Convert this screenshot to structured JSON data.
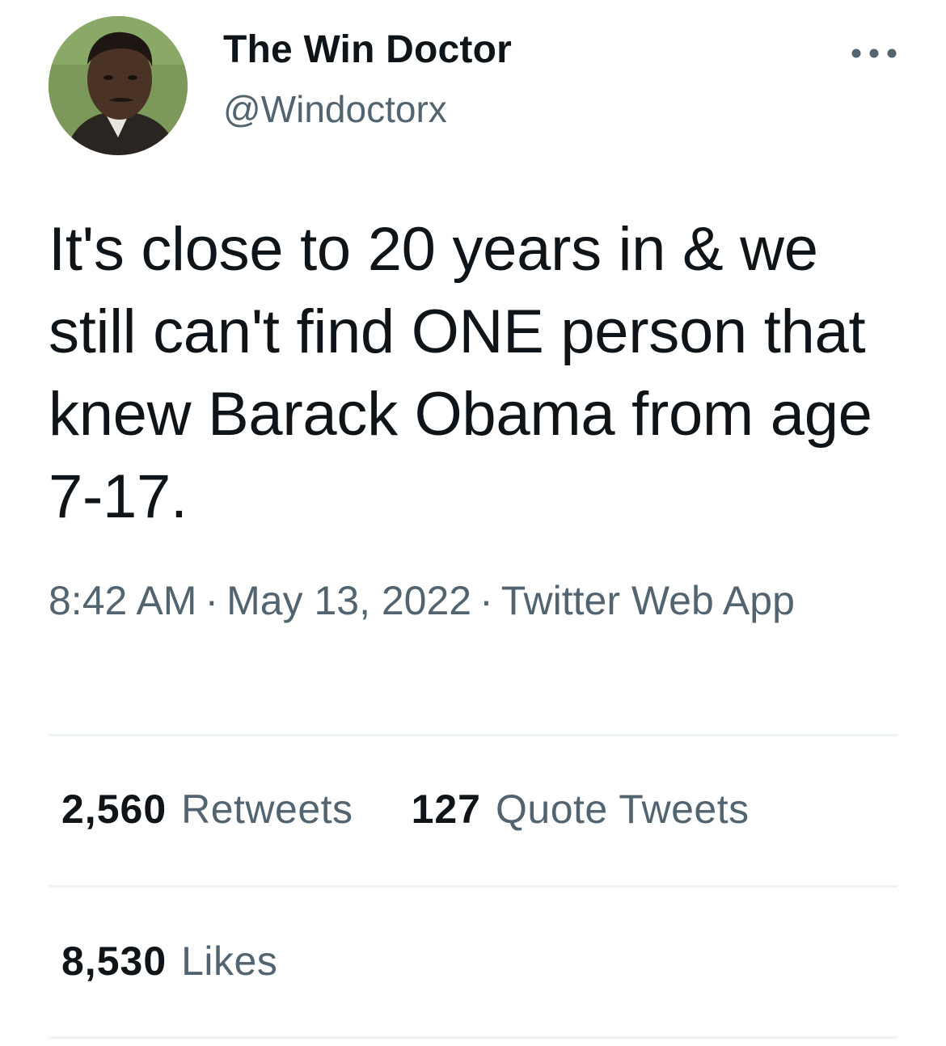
{
  "author": {
    "display_name": "The Win Doctor",
    "handle": "@Windoctorx",
    "avatar_icon": "profile-photo"
  },
  "more_icon": "more-horizontal-icon",
  "tweet": {
    "text": "It's close to 20 years in & we still can't find ONE person that knew Barack Obama from age 7-17.",
    "time": "8:42 AM",
    "date": "May 13, 2022",
    "source": "Twitter Web App",
    "separator": "·"
  },
  "stats": {
    "retweets": {
      "count": "2,560",
      "label": "Retweets"
    },
    "quote_tweets": {
      "count": "127",
      "label": "Quote Tweets"
    },
    "likes": {
      "count": "8,530",
      "label": "Likes"
    }
  },
  "colors": {
    "text_primary": "#0f1419",
    "text_secondary": "#536471",
    "divider": "#eff3f4"
  }
}
